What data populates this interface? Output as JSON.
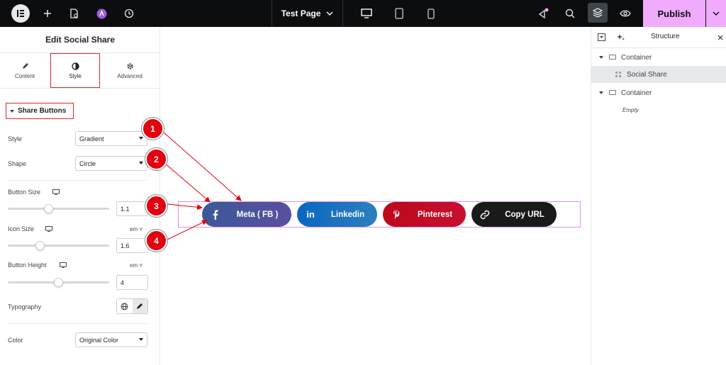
{
  "topbar": {
    "page_title": "Test Page",
    "publish_label": "Publish"
  },
  "panel": {
    "title": "Edit Social Share",
    "tabs": [
      {
        "label": "Content",
        "icon": "pencil-icon"
      },
      {
        "label": "Style",
        "icon": "contrast-icon"
      },
      {
        "label": "Advanced",
        "icon": "gear-icon"
      }
    ],
    "section_title": "Share Buttons",
    "style_label": "Style",
    "style_value": "Gradient",
    "shape_label": "Shape",
    "shape_value": "Circle",
    "button_size_label": "Button Size",
    "button_size_value": "1.1",
    "button_size_level": 0.4,
    "icon_size_label": "Icon Size",
    "icon_size_unit": "em",
    "icon_size_value": "1.6",
    "icon_size_level": 0.32,
    "button_height_label": "Button Height",
    "button_height_unit": "em",
    "button_height_value": "4",
    "button_height_level": 0.5,
    "typography_label": "Typography",
    "color_label": "Color",
    "color_value": "Original Color"
  },
  "canvas": {
    "buttons": [
      {
        "label": "Meta ( FB )",
        "icon": "facebook-icon",
        "color": "#3b5998"
      },
      {
        "label": "Linkedin",
        "icon": "linkedin-icon",
        "color": "#0077b5"
      },
      {
        "label": "Pinterest",
        "icon": "pinterest-icon",
        "color": "#bd081c"
      },
      {
        "label": "Copy URL",
        "icon": "link-icon",
        "color": "#1a1a1a"
      }
    ],
    "annotations": [
      "1",
      "2",
      "3",
      "4"
    ]
  },
  "structure": {
    "title": "Structure",
    "items": [
      {
        "label": "Container"
      },
      {
        "label": "Social Share"
      },
      {
        "label": "Container"
      },
      {
        "label": "Empty"
      }
    ]
  },
  "colors": {
    "accent": "#f0abfc",
    "annotation": "#e3000f",
    "highlight_border": "#d9272e"
  }
}
